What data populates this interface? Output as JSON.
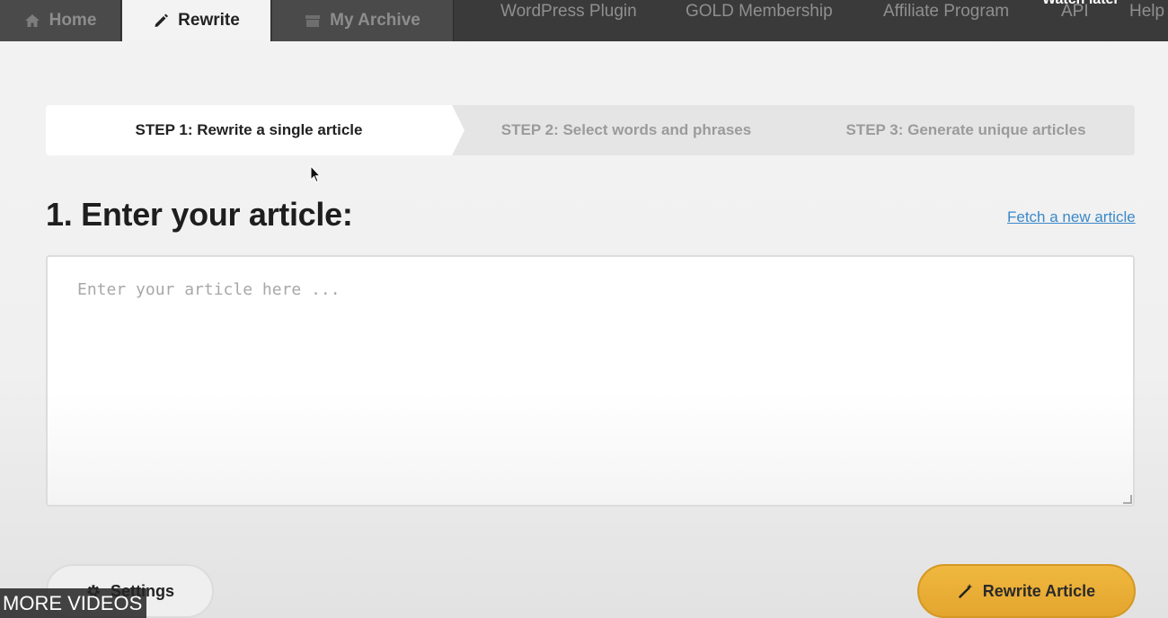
{
  "nav": {
    "tabs": [
      {
        "label": "Home",
        "icon": "home-icon"
      },
      {
        "label": "Rewrite",
        "icon": "pencil-icon",
        "active": true
      },
      {
        "label": "My Archive",
        "icon": "archive-icon"
      }
    ],
    "links": [
      "WordPress Plugin",
      "GOLD Membership",
      "Affiliate Program",
      "API",
      "Help"
    ],
    "overlay_text": "Watch later"
  },
  "steps": [
    {
      "label": "STEP 1: Rewrite a single article",
      "active": true
    },
    {
      "label": "STEP 2: Select words and phrases",
      "active": false
    },
    {
      "label": "STEP 3: Generate unique articles",
      "active": false
    }
  ],
  "main": {
    "heading": "1. Enter your article:",
    "fetch_link": "Fetch a new article",
    "article_placeholder": "Enter your article here ...",
    "article_value": ""
  },
  "buttons": {
    "settings_label": "Settings",
    "rewrite_label": "Rewrite Article"
  },
  "video_overlay": {
    "more_videos": "MORE VIDEOS"
  },
  "colors": {
    "nav_background": "#3a3a3a",
    "accent_button": "#e8ac35",
    "link": "#3a89c9"
  }
}
